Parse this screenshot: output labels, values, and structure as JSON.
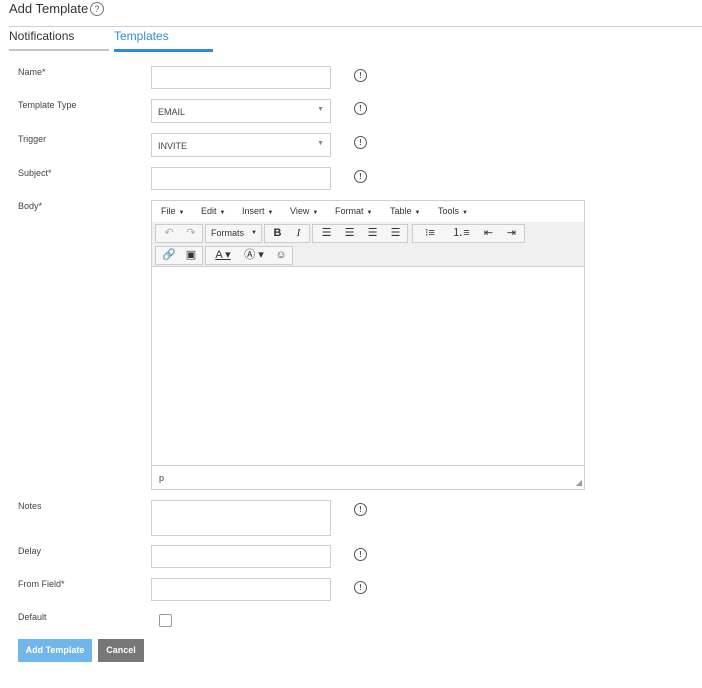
{
  "header": {
    "title": "Add Template",
    "help_icon": "?"
  },
  "tabs": {
    "notifications": "Notifications",
    "templates": "Templates"
  },
  "form": {
    "name_label": "Name*",
    "type_label": "Template Type",
    "type_value": "EMAIL",
    "trigger_label": "Trigger",
    "trigger_value": "INVITE",
    "subject_label": "Subject*",
    "body_label": "Body*",
    "notes_label": "Notes",
    "delay_label": "Delay",
    "from_label": "From Field*",
    "default_label": "Default",
    "info_glyph": "!",
    "select_arrow": "▼"
  },
  "editor": {
    "menus": [
      "File",
      "Edit",
      "Insert",
      "View",
      "Format",
      "Table",
      "Tools"
    ],
    "formats_label": "Formats",
    "status_path": "p",
    "resize_glyph": "◢"
  },
  "buttons": {
    "add": "Add Template",
    "cancel": "Cancel"
  },
  "colors": {
    "accent": "#2c8fd6",
    "primary_button": "#6fb7ea",
    "secondary_button": "#777777"
  }
}
